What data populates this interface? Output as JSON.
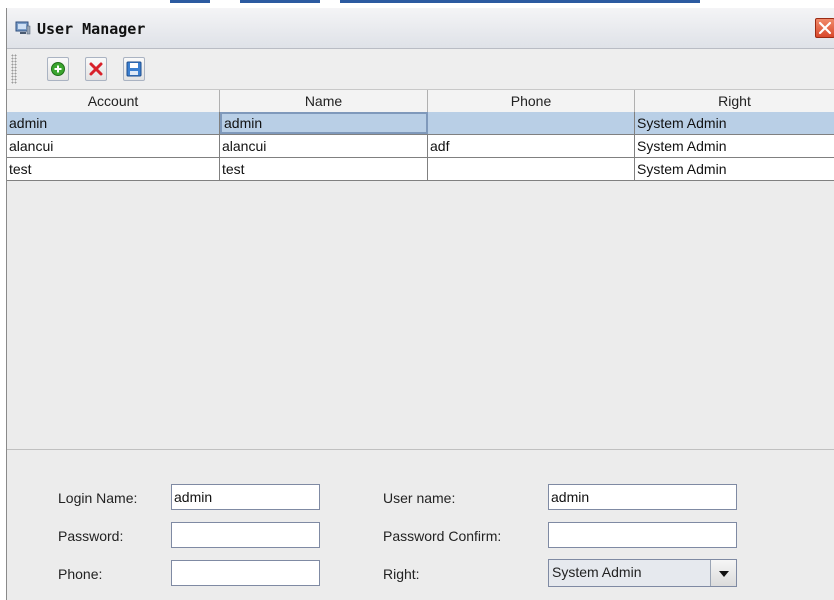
{
  "window": {
    "title": "User Manager"
  },
  "toolbar": {
    "buttons": [
      {
        "name": "add",
        "icon": "add-icon"
      },
      {
        "name": "delete",
        "icon": "delete-icon"
      },
      {
        "name": "save",
        "icon": "save-icon"
      }
    ]
  },
  "table": {
    "columns": [
      "Account",
      "Name",
      "Phone",
      "Right"
    ],
    "rows": [
      [
        "admin",
        "admin",
        "",
        "System Admin"
      ],
      [
        "alancui",
        "alancui",
        "adf",
        "System Admin"
      ],
      [
        "test",
        "test",
        "",
        "System Admin"
      ]
    ],
    "selected_row": 0
  },
  "form": {
    "login_name_label": "Login Name:",
    "login_name_value": "admin",
    "password_label": "Password:",
    "password_value": "",
    "phone_label": "Phone:",
    "phone_value": "",
    "user_name_label": "User name:",
    "user_name_value": "admin",
    "password_confirm_label": "Password Confirm:",
    "password_confirm_value": "",
    "right_label": "Right:",
    "right_value": "System Admin"
  },
  "colors": {
    "selection": "#b9cfe6",
    "close_button": "#d9482c",
    "add_icon": "#3aa52e",
    "delete_icon": "#d8212a",
    "save_icon": "#3b7fd0"
  }
}
